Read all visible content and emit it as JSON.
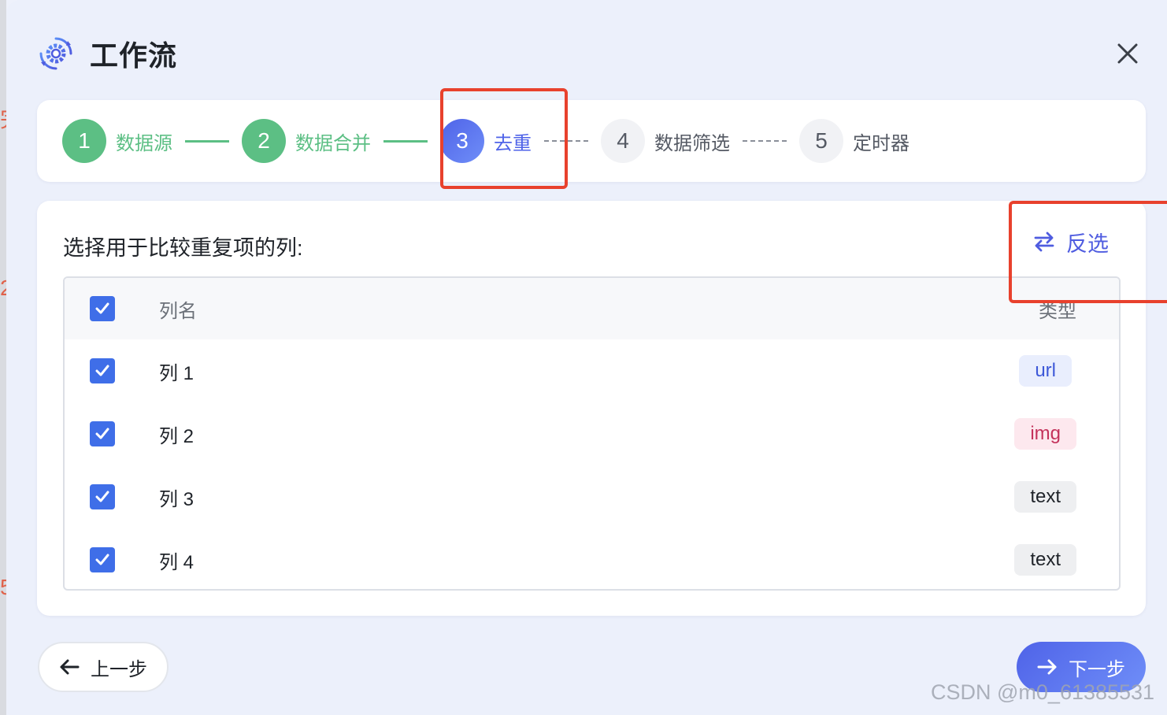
{
  "dialog": {
    "title": "工作流",
    "logo_icon": "gear-cycle-icon",
    "close_icon": "close-icon"
  },
  "steps": [
    {
      "number": "1",
      "label": "数据源",
      "state": "done"
    },
    {
      "number": "2",
      "label": "数据合并",
      "state": "done"
    },
    {
      "number": "3",
      "label": "去重",
      "state": "active"
    },
    {
      "number": "4",
      "label": "数据筛选",
      "state": "todo"
    },
    {
      "number": "5",
      "label": "定时器",
      "state": "todo"
    }
  ],
  "main": {
    "section_title": "选择用于比较重复项的列:",
    "invert_button": "反选",
    "invert_icon": "swap-arrows-icon",
    "table": {
      "header": {
        "name": "列名",
        "type": "类型",
        "checked": true
      },
      "rows": [
        {
          "name": "列 1",
          "type": "url",
          "checked": true
        },
        {
          "name": "列 2",
          "type": "img",
          "checked": true
        },
        {
          "name": "列 3",
          "type": "text",
          "checked": true
        },
        {
          "name": "列 4",
          "type": "text",
          "checked": true
        }
      ]
    }
  },
  "footer": {
    "prev_label": "上一步",
    "next_label": "下一步"
  },
  "watermark": "CSDN @m0_61385531",
  "colors": {
    "done": "#5cbf84",
    "active": "#4f63e8",
    "annotation": "#e8412d",
    "checkbox": "#3f6ee8"
  }
}
